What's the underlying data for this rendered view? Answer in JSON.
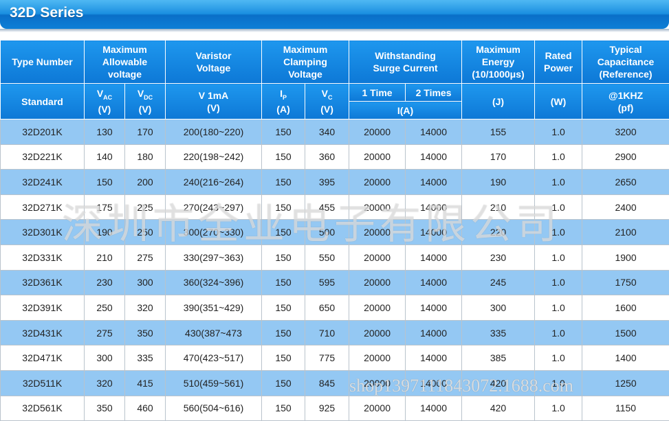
{
  "title": "32D Series",
  "header": {
    "type_number": "Type Number",
    "max_voltage": "Maximum Allowable voltage",
    "varistor": "Varistor Voltage",
    "clamping": "Maximum Clamping Voltage",
    "surge": "Withstanding Surge Current",
    "energy": "Maximum Energy (10/1000μs)",
    "power": "Rated Power",
    "capacitance": "Typical Capacitance (Reference)",
    "standard": "Standard",
    "vac_unit": "(V)",
    "vdc_unit": "(V)",
    "v1ma": "V 1mA",
    "v1ma_unit": "(V)",
    "ip_unit": "(A)",
    "vc_unit": "(V)",
    "once": "1 Time",
    "twice": "2 Times",
    "surge_unit": "I(A)",
    "energy_unit": "(J)",
    "power_unit": "(W)",
    "cap_freq": "@1KHZ",
    "cap_unit": "(pf)"
  },
  "rows": [
    [
      "32D201K",
      "130",
      "170",
      "200(180~220)",
      "150",
      "340",
      "20000",
      "14000",
      "155",
      "1.0",
      "3200"
    ],
    [
      "32D221K",
      "140",
      "180",
      "220(198~242)",
      "150",
      "360",
      "20000",
      "14000",
      "170",
      "1.0",
      "2900"
    ],
    [
      "32D241K",
      "150",
      "200",
      "240(216~264)",
      "150",
      "395",
      "20000",
      "14000",
      "190",
      "1.0",
      "2650"
    ],
    [
      "32D271K",
      "175",
      "225",
      "270(243~297)",
      "150",
      "455",
      "20000",
      "14000",
      "210",
      "1.0",
      "2400"
    ],
    [
      "32D301K",
      "190",
      "250",
      "300(270~330)",
      "150",
      "500",
      "20000",
      "14000",
      "220",
      "1.0",
      "2100"
    ],
    [
      "32D331K",
      "210",
      "275",
      "330(297~363)",
      "150",
      "550",
      "20000",
      "14000",
      "230",
      "1.0",
      "1900"
    ],
    [
      "32D361K",
      "230",
      "300",
      "360(324~396)",
      "150",
      "595",
      "20000",
      "14000",
      "245",
      "1.0",
      "1750"
    ],
    [
      "32D391K",
      "250",
      "320",
      "390(351~429)",
      "150",
      "650",
      "20000",
      "14000",
      "300",
      "1.0",
      "1600"
    ],
    [
      "32D431K",
      "275",
      "350",
      "430(387~473",
      "150",
      "710",
      "20000",
      "14000",
      "335",
      "1.0",
      "1500"
    ],
    [
      "32D471K",
      "300",
      "335",
      "470(423~517)",
      "150",
      "775",
      "20000",
      "14000",
      "385",
      "1.0",
      "1400"
    ],
    [
      "32D511K",
      "320",
      "415",
      "510(459~561)",
      "150",
      "845",
      "20000",
      "14000",
      "420",
      "1.0",
      "1250"
    ],
    [
      "32D561K",
      "350",
      "460",
      "560(504~616)",
      "150",
      "925",
      "20000",
      "14000",
      "420",
      "1.0",
      "1150"
    ]
  ],
  "watermark": "深圳市全业电子有限公司",
  "watermark_url": "shop1397111843072.1688.com"
}
